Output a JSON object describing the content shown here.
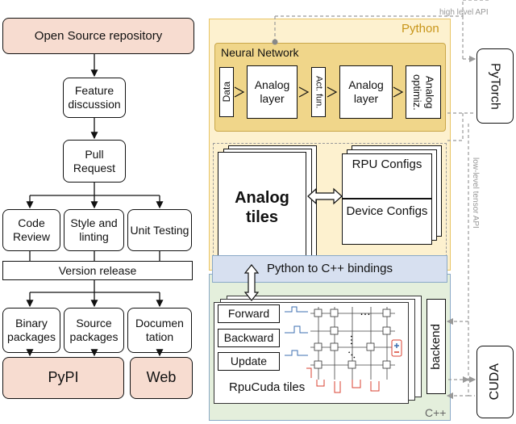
{
  "left_workflow": {
    "repo": "Open Source repository",
    "feature": "Feature discussion",
    "pull_request": "Pull Request",
    "checks": [
      "Code Review",
      "Style and linting",
      "Unit Testing"
    ],
    "version_release": "Version release",
    "outputs": [
      "Binary packages",
      "Source packages",
      "Documen tation"
    ],
    "destinations": [
      "PyPI",
      "Web"
    ]
  },
  "python_block": {
    "label": "Python",
    "nn_label": "Neural Network",
    "nn_items": [
      "Data",
      "Analog layer",
      "Act. fun.",
      "Analog layer",
      "Analog optimiz."
    ],
    "tiles": "Analog tiles",
    "rpu_configs": "RPU Configs",
    "device_configs": "Device Configs"
  },
  "bindings": "Python to C++ bindings",
  "cpp_block": {
    "label": "C++",
    "ops": [
      "Forward",
      "Backward",
      "Update"
    ],
    "tiles_label": "RpuCuda tiles",
    "backend": "backend",
    "dots": "..."
  },
  "external": {
    "pytorch": "PyTorch",
    "cuda": "CUDA",
    "high_level_api": "high level API",
    "low_level_api": "low-level tensor API"
  },
  "colors": {
    "pink": "#f7dcd0",
    "python_bg": "#fdf1cf",
    "python_border": "#e8c463",
    "nn_bg": "#f0d68a",
    "cpp_bg": "#e4efdc",
    "cpp_border": "#8aa9c7",
    "bindings_bg": "#d7e0f0",
    "label_orange": "#c8951a"
  }
}
